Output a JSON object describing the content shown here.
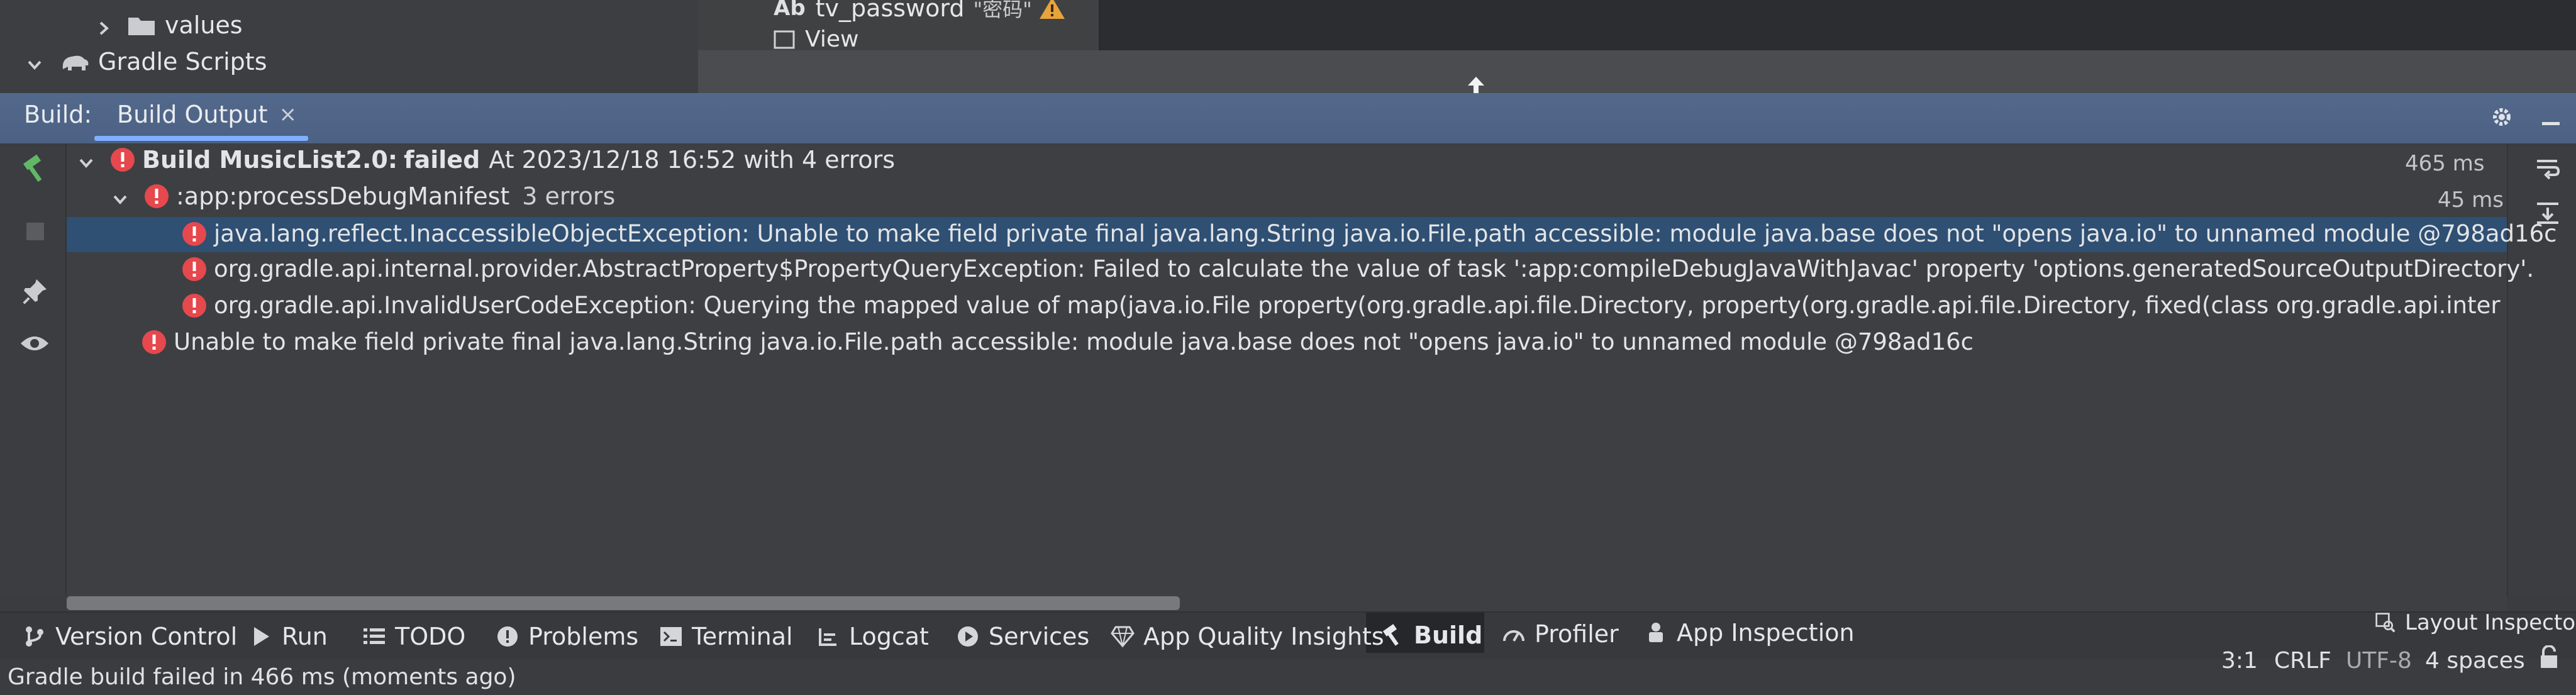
{
  "project_tree": {
    "values_folder": "values",
    "gradle_scripts": "Gradle Scripts"
  },
  "layout_preview": {
    "ab_glyph": "Ab",
    "tv_password_label": "tv_password",
    "tv_password_text": "\"密码\"",
    "view_item": "View"
  },
  "build_window": {
    "label": "Build:",
    "tab_label": "Build Output",
    "tab_close": "×"
  },
  "build_output": {
    "root": {
      "name": "Build MusicList2.0:",
      "status": "failed",
      "detail": "At 2023/12/18 16:52 with 4 errors",
      "time": "465 ms"
    },
    "task": {
      "name": ":app:processDebugManifest",
      "count": "3 errors",
      "time": "45 ms"
    },
    "task_errors": [
      "java.lang.reflect.InaccessibleObjectException: Unable to make field private final java.lang.String java.io.File.path accessible: module java.base does not \"opens java.io\" to unnamed module @798ad16c",
      "org.gradle.api.internal.provider.AbstractProperty$PropertyQueryException: Failed to calculate the value of task ':app:compileDebugJavaWithJavac' property 'options.generatedSourceOutputDirectory'.",
      "org.gradle.api.InvalidUserCodeException: Querying the mapped value of map(java.io.File property(org.gradle.api.file.Directory, property(org.gradle.api.file.Directory, fixed(class org.gradle.api.internal.file.DefaultFilePropert"
    ],
    "root_error": "Unable to make field private final java.lang.String java.io.File.path accessible: module java.base does not \"opens java.io\" to unnamed module @798ad16c"
  },
  "bottom_tools": {
    "version_control": "Version Control",
    "run": "Run",
    "todo": "TODO",
    "problems": "Problems",
    "terminal": "Terminal",
    "logcat": "Logcat",
    "services": "Services",
    "app_quality": "App Quality Insights",
    "build": "Build",
    "profiler": "Profiler",
    "app_inspection": "App Inspection",
    "layout_inspector": "Layout Inspector"
  },
  "status_bar": {
    "message": "Gradle build failed in 466 ms (moments ago)",
    "position": "3:1",
    "line_sep": "CRLF",
    "encoding": "UTF-8",
    "indent": "4 spaces"
  },
  "colors": {
    "error_red": "#e5484d",
    "selection": "#2f4f73",
    "header_blue": "#536a8f",
    "build_hammer_green": "#5fb865"
  },
  "icons": {
    "error": "error-circle-icon",
    "folder": "folder-icon",
    "gradle": "elephant-icon",
    "warning": "warning-triangle-icon",
    "settings": "gear-icon",
    "minimize": "minimize-icon",
    "hammer": "hammer-icon"
  }
}
